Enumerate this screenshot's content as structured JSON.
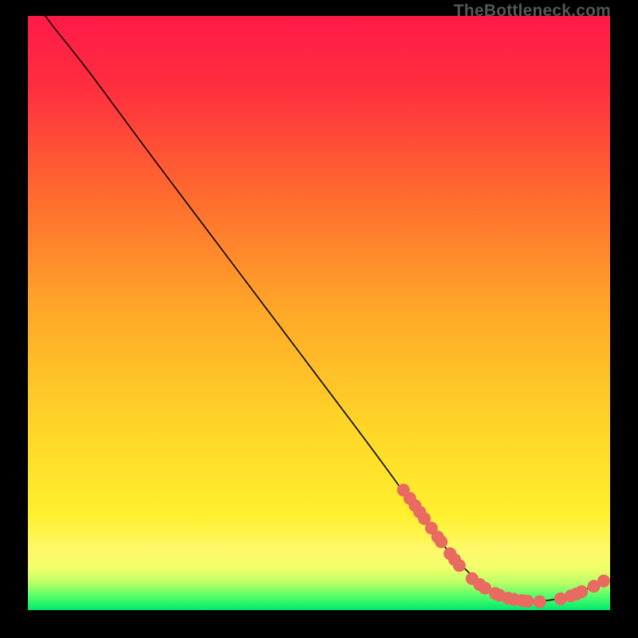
{
  "watermark": "TheBottleneck.com",
  "chart_data": {
    "type": "line",
    "title": "",
    "xlabel": "",
    "ylabel": "",
    "xlim": [
      0,
      100
    ],
    "ylim": [
      0,
      100
    ],
    "grid": false,
    "legend": false,
    "background_gradient": {
      "top": "#ff1a47",
      "mid1": "#ff8a2b",
      "mid2": "#ffe629",
      "band": "#fff35a",
      "bottom": "#00e96c"
    },
    "curve": {
      "name": "bottleneck-curve",
      "color": "#000000",
      "points": [
        {
          "x": 3.0,
          "y": 100.0
        },
        {
          "x": 4.5,
          "y": 98.0
        },
        {
          "x": 7.0,
          "y": 95.0
        },
        {
          "x": 11.0,
          "y": 90.0
        },
        {
          "x": 20.0,
          "y": 78.0
        },
        {
          "x": 30.0,
          "y": 65.0
        },
        {
          "x": 40.0,
          "y": 52.0
        },
        {
          "x": 50.0,
          "y": 39.0
        },
        {
          "x": 60.0,
          "y": 26.0
        },
        {
          "x": 67.0,
          "y": 16.5
        },
        {
          "x": 72.0,
          "y": 10.0
        },
        {
          "x": 77.0,
          "y": 5.0
        },
        {
          "x": 82.0,
          "y": 2.0
        },
        {
          "x": 87.0,
          "y": 1.3
        },
        {
          "x": 92.0,
          "y": 2.0
        },
        {
          "x": 96.0,
          "y": 3.5
        },
        {
          "x": 99.0,
          "y": 5.0
        }
      ]
    },
    "markers": {
      "name": "highlight-dots",
      "color": "#e86a60",
      "radius": 1.1,
      "points": [
        {
          "x": 64.5,
          "y": 20.2
        },
        {
          "x": 65.6,
          "y": 18.8
        },
        {
          "x": 66.5,
          "y": 17.6
        },
        {
          "x": 67.3,
          "y": 16.5
        },
        {
          "x": 68.1,
          "y": 15.4
        },
        {
          "x": 69.3,
          "y": 13.8
        },
        {
          "x": 70.4,
          "y": 12.3
        },
        {
          "x": 71.0,
          "y": 11.5
        },
        {
          "x": 72.5,
          "y": 9.5
        },
        {
          "x": 73.3,
          "y": 8.5
        },
        {
          "x": 74.1,
          "y": 7.5
        },
        {
          "x": 76.3,
          "y": 5.3
        },
        {
          "x": 77.6,
          "y": 4.3
        },
        {
          "x": 78.5,
          "y": 3.7
        },
        {
          "x": 80.3,
          "y": 2.8
        },
        {
          "x": 81.0,
          "y": 2.5
        },
        {
          "x": 82.5,
          "y": 2.0
        },
        {
          "x": 83.5,
          "y": 1.8
        },
        {
          "x": 84.9,
          "y": 1.6
        },
        {
          "x": 85.8,
          "y": 1.5
        },
        {
          "x": 87.9,
          "y": 1.4
        },
        {
          "x": 91.5,
          "y": 1.9
        },
        {
          "x": 93.3,
          "y": 2.4
        },
        {
          "x": 94.2,
          "y": 2.7
        },
        {
          "x": 95.1,
          "y": 3.1
        },
        {
          "x": 97.2,
          "y": 4.0
        },
        {
          "x": 98.9,
          "y": 4.9
        }
      ]
    }
  }
}
